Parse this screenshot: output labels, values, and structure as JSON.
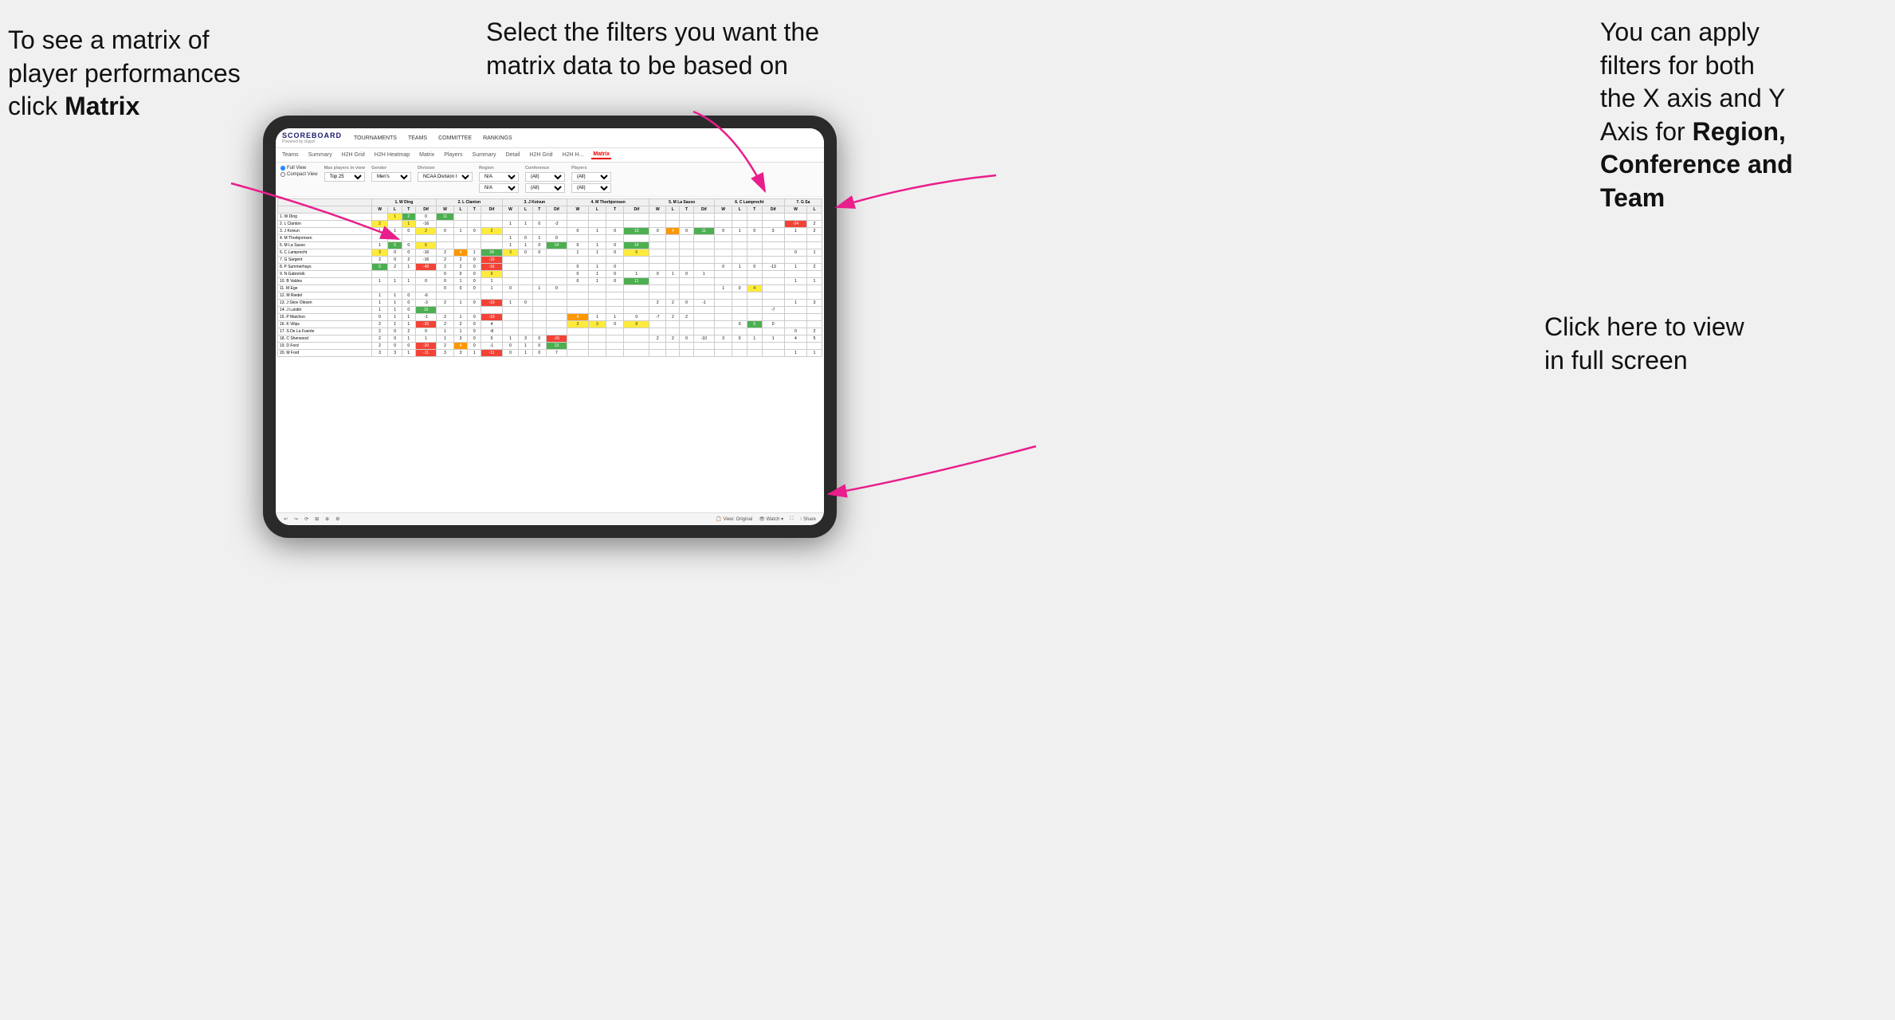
{
  "annotations": {
    "left": {
      "line1": "To see a matrix of",
      "line2": "player performances",
      "line3_prefix": "click ",
      "line3_bold": "Matrix"
    },
    "center": {
      "text": "Select the filters you want the matrix data to be based on"
    },
    "right": {
      "line1": "You  can apply",
      "line2": "filters for both",
      "line3": "the X axis and Y",
      "line4_prefix": "Axis for ",
      "line4_bold": "Region,",
      "line5_bold": "Conference and",
      "line6_bold": "Team"
    },
    "bottom_right": {
      "line1": "Click here to view",
      "line2": "in full screen"
    }
  },
  "scoreboard": {
    "logo": "SCOREBOARD",
    "powered_by": "Powered by clippd",
    "nav": [
      "TOURNAMENTS",
      "TEAMS",
      "COMMITTEE",
      "RANKINGS"
    ],
    "sub_nav": [
      "Teams",
      "Summary",
      "H2H Grid",
      "H2H Heatmap",
      "Matrix",
      "Players",
      "Summary",
      "Detail",
      "H2H Grid",
      "H2H H...",
      "Matrix"
    ],
    "active_tab": "Matrix"
  },
  "filters": {
    "view_options": [
      "Full View",
      "Compact View"
    ],
    "max_players_label": "Max players in view",
    "max_players_value": "Top 25",
    "gender_label": "Gender",
    "gender_value": "Men's",
    "division_label": "Division",
    "division_value": "NCAA Division I",
    "region_label": "Region",
    "region_value": "N/A",
    "conference_label": "Conference",
    "conference_value_1": "(All)",
    "conference_value_2": "(All)",
    "players_label": "Players",
    "players_value_1": "(All)",
    "players_value_2": "(All)"
  },
  "matrix_headers": {
    "col_headers": [
      "1. W Ding",
      "2. L Clanton",
      "3. J Koivun",
      "4. M Thorbjornsen",
      "5. M La Sasso",
      "6. C Lamprecht",
      "7. G Sa"
    ],
    "sub_headers": [
      "W",
      "L",
      "T",
      "Dif",
      "W",
      "L",
      "T",
      "Dif",
      "W",
      "L",
      "T",
      "Dif",
      "W",
      "L",
      "T",
      "Dif",
      "W",
      "L",
      "T",
      "Dif",
      "W",
      "L",
      "T",
      "Dif",
      "W",
      "L"
    ]
  },
  "players": [
    "1. W Ding",
    "2. L Clanton",
    "3. J Koivun",
    "4. M Thorbjornsen",
    "5. M La Sasso",
    "6. C Lamprecht",
    "7. G Sargent",
    "8. P Summerhays",
    "9. N Gabrelcik",
    "10. B Valdes",
    "11. M Ege",
    "12. M Riedel",
    "13. J Skov Olesen",
    "14. J Lundin",
    "15. P Maichon",
    "16. K Vilips",
    "17. S De La Fuente",
    "18. C Sherwood",
    "19. D Ford",
    "20. M Ford"
  ],
  "toolbar": {
    "view_label": "View: Original",
    "watch_label": "Watch",
    "share_label": "Share"
  },
  "colors": {
    "accent_red": "#e00020",
    "arrow_pink": "#e91e8c",
    "dark_green": "#2e7d32",
    "green": "#4caf50",
    "yellow": "#ffeb3b",
    "orange": "#ff9800"
  }
}
